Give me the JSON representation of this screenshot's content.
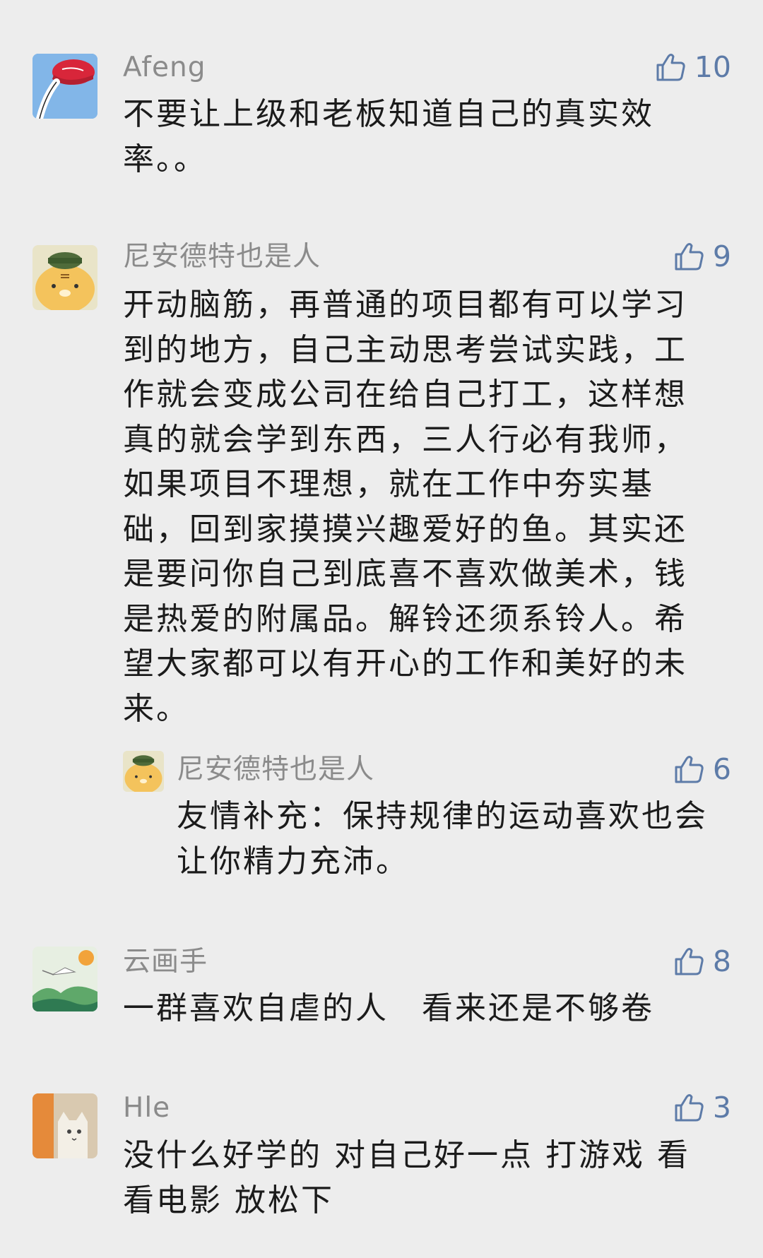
{
  "comments": [
    {
      "user": "Afeng",
      "avatar": "red-cap-avatar",
      "text": "不要让上级和老板知道自己的真实效率。。",
      "likes": "10"
    },
    {
      "user": "尼安德特也是人",
      "avatar": "tiger-avatar",
      "text": "开动脑筋，再普通的项目都有可以学习到的地方，自己主动思考尝试实践，工作就会变成公司在给自己打工，这样想真的就会学到东西，三人行必有我师，如果项目不理想，就在工作中夯实基础，回到家摸摸兴趣爱好的鱼。其实还是要问你自己到底喜不喜欢做美术，钱是热爱的附属品。解铃还须系铃人。希望大家都可以有开心的工作和美好的未来。",
      "likes": "9",
      "reply": {
        "user": "尼安德特也是人",
        "avatar": "tiger-avatar",
        "text": "友情补充：保持规律的运动喜欢也会让你精力充沛。",
        "likes": "6"
      }
    },
    {
      "user": "云画手",
      "avatar": "crane-landscape-avatar",
      "text": "一群喜欢自虐的人　看来还是不够卷",
      "likes": "8"
    },
    {
      "user": "Hle",
      "avatar": "cat-avatar",
      "text": "没什么好学的 对自己好一点 打游戏 看看电影 放松下",
      "likes": "3"
    }
  ],
  "colors": {
    "background": "#ededed",
    "username": "#8b8b8b",
    "text": "#1b1b1b",
    "like": "#5d7ba8"
  },
  "icons": [
    "thumbs-up-icon"
  ]
}
